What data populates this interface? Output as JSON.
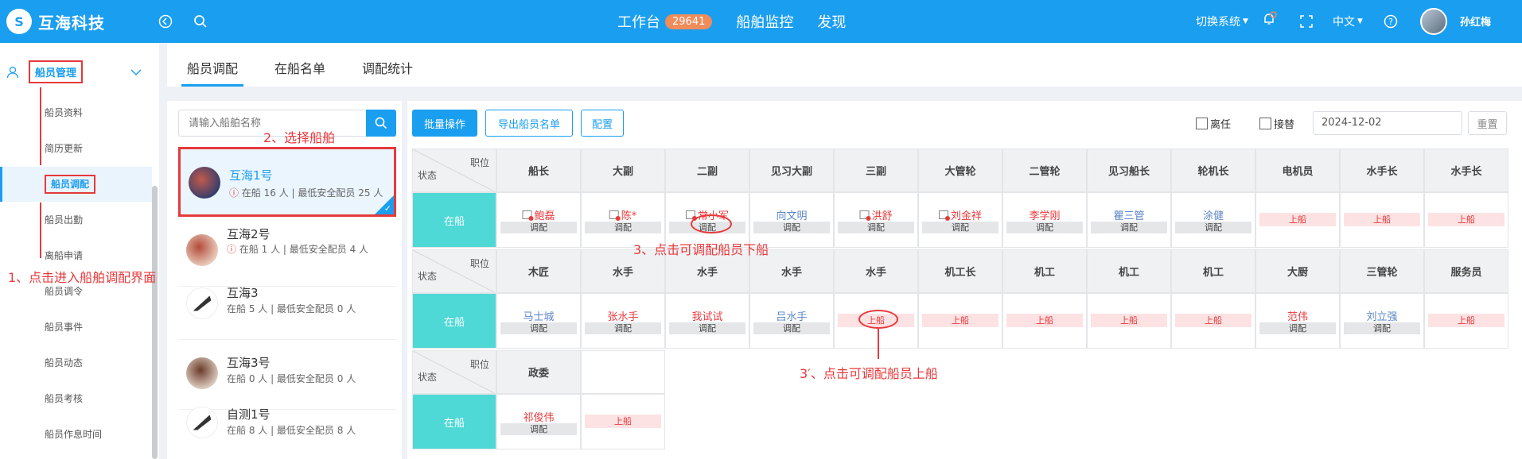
{
  "header": {
    "logo_mark": "S",
    "logo_text": "互海科技",
    "nav": [
      {
        "label": "工作台",
        "badge": "29641"
      },
      {
        "label": "船舶监控"
      },
      {
        "label": "发现"
      }
    ],
    "switch_system": "切换系统",
    "language": "中文",
    "username": "孙红梅",
    "icons": [
      "back-icon",
      "search-icon",
      "bell-icon",
      "fullscreen-icon",
      "help-icon"
    ]
  },
  "sidebar": {
    "section": "船员管理",
    "items": [
      "船员资料",
      "简历更新",
      "船员调配",
      "船员出勤",
      "离船申请",
      "船员调令",
      "船员事件",
      "船员动态",
      "船员考核",
      "船员作息时间"
    ]
  },
  "tabs": [
    "船员调配",
    "在船名单",
    "调配统计"
  ],
  "ship_search": {
    "placeholder": "请输入船舶名称"
  },
  "ships": [
    {
      "name": "互海1号",
      "info": "在船 16 人 | 最低安全配员 25 人"
    },
    {
      "name": "互海2号",
      "info": "在船 1 人 | 最低安全配员 4 人"
    },
    {
      "name": "互海3",
      "info": "在船 5 人 | 最低安全配员 0 人"
    },
    {
      "name": "互海3号",
      "info": "在船 0 人 | 最低安全配员 0 人"
    },
    {
      "name": "自测1号",
      "info": "在船 8 人 | 最低安全配员 8 人"
    }
  ],
  "toolbar": {
    "batch": "批量操作",
    "export": "导出船员名单",
    "config": "配置",
    "leave": "离任",
    "relief": "接替",
    "date": "2024-12-02",
    "reset": "重置"
  },
  "grid": {
    "corner_position": "职位",
    "corner_status": "状态",
    "status_label": "在船",
    "adjust_label": "调配",
    "board_label": "上船",
    "rows": [
      {
        "positions": [
          "船长",
          "大副",
          "二副",
          "见习大副",
          "三副",
          "大管轮",
          "二管轮",
          "见习船长",
          "轮机长",
          "电机员",
          "水手长",
          "水手长"
        ],
        "crew": [
          "鲍磊",
          "陈*",
          "常小军",
          "向文明",
          "洪舒",
          "刘金祥",
          "李学刚",
          "瞿三管",
          "涂健",
          "",
          "",
          ""
        ]
      },
      {
        "positions": [
          "木匠",
          "水手",
          "水手",
          "水手",
          "水手",
          "机工长",
          "机工",
          "机工",
          "机工",
          "大厨",
          "三管轮",
          "服务员"
        ],
        "crew": [
          "马士城",
          "张水手",
          "我试试",
          "吕水手",
          "",
          "",
          "",
          "",
          "",
          "范伟",
          "刘立强",
          ""
        ]
      },
      {
        "positions": [
          "政委",
          ""
        ],
        "crew": [
          "祁俊伟",
          ""
        ]
      }
    ]
  },
  "annotations": {
    "a1": "1、点击进入船舶调配界面",
    "a2": "2、选择船舶",
    "a3": "3、点击可调配船员下船",
    "a4": "3′、点击可调配船员上船"
  }
}
